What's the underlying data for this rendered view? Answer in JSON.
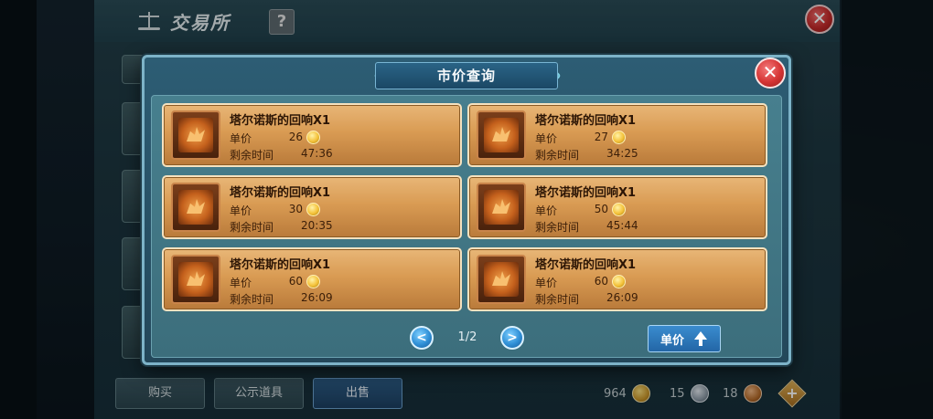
{
  "exchange": {
    "title": "交易所",
    "help_label": "?",
    "close_label": "✕",
    "tabs": [
      {
        "label": "购买"
      },
      {
        "label": "公示道具"
      },
      {
        "label": "出售"
      }
    ],
    "currency": {
      "gold": "964",
      "silver": "15",
      "bronze": "18"
    },
    "add_label": "+"
  },
  "modal": {
    "title": "市价查询",
    "close_label": "✕",
    "price_label": "单价",
    "time_label": "剩余时间",
    "listings": [
      {
        "name": "塔尔诺斯的回响X1",
        "price": "26",
        "time": "47:36"
      },
      {
        "name": "塔尔诺斯的回响X1",
        "price": "27",
        "time": "34:25"
      },
      {
        "name": "塔尔诺斯的回响X1",
        "price": "30",
        "time": "20:35"
      },
      {
        "name": "塔尔诺斯的回响X1",
        "price": "50",
        "time": "45:44"
      },
      {
        "name": "塔尔诺斯的回响X1",
        "price": "60",
        "time": "26:09"
      },
      {
        "name": "塔尔诺斯的回响X1",
        "price": "60",
        "time": "26:09"
      }
    ],
    "pagination": {
      "prev_label": "<",
      "next_label": ">",
      "page": "1/2"
    },
    "sort_label": "单价"
  }
}
